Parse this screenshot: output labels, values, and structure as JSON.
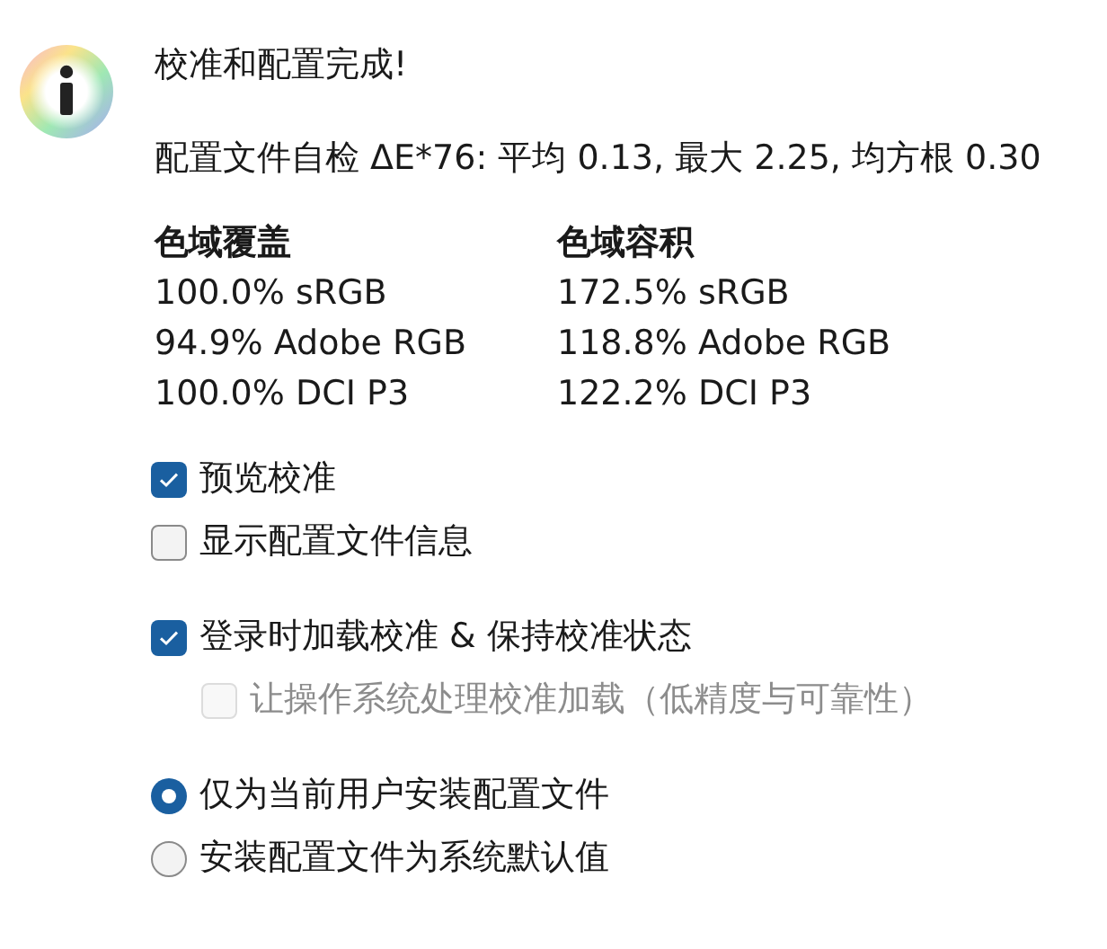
{
  "message": {
    "title": "校准和配置完成!",
    "summary": "配置文件自检 ΔE*76: 平均 0.13, 最大 2.25, 均方根 0.30"
  },
  "gamut": [
    {
      "heading": "色域覆盖",
      "values": [
        "100.0% sRGB",
        "94.9% Adobe RGB",
        "100.0% DCI P3"
      ]
    },
    {
      "heading": "色域容积",
      "values": [
        "172.5% sRGB",
        "118.8% Adobe RGB",
        "122.2% DCI P3"
      ]
    }
  ],
  "option_groups": [
    [
      {
        "kind": "checkbox",
        "label": "预览校准",
        "checked": true,
        "disabled": false
      },
      {
        "kind": "checkbox",
        "label": "显示配置文件信息",
        "checked": false,
        "disabled": false
      }
    ],
    [
      {
        "kind": "checkbox",
        "label": "登录时加载校准 & 保持校准状态",
        "checked": true,
        "disabled": false,
        "children": [
          {
            "kind": "checkbox",
            "label": "让操作系统处理校准加载（低精度与可靠性）",
            "checked": false,
            "disabled": true
          }
        ]
      }
    ],
    [
      {
        "kind": "radio",
        "label": "仅为当前用户安装配置文件",
        "selected": true,
        "disabled": false
      },
      {
        "kind": "radio",
        "label": "安装配置文件为系统默认值",
        "selected": false,
        "disabled": false
      }
    ]
  ]
}
